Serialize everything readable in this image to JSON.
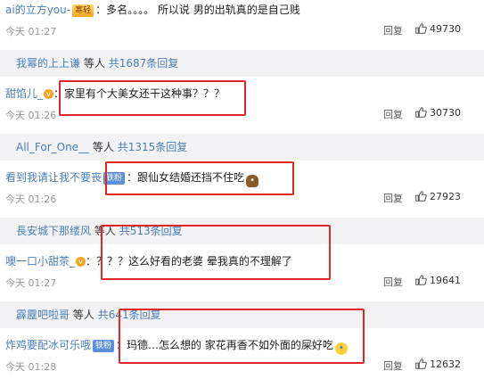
{
  "comments": [
    {
      "username": "ai的立方you-",
      "badge": "寒轻",
      "text": "多名。。。。 所以说 男的出轨真的是自己贱",
      "time": "今天 01:27",
      "reply": "回复",
      "likes": "49730"
    },
    {
      "username": "甜馅儿_",
      "badge": "",
      "text": "家里有个大美女还干这种事？？？",
      "time": "今天 01:26",
      "reply": "回复",
      "likes": "30730"
    },
    {
      "username": "看到我请让我不要丧",
      "badge": "铁粉",
      "text": "跟仙女结婚还挡不住吃",
      "emoji": "poop-icon",
      "time": "今天 01:26",
      "reply": "回复",
      "likes": "27923"
    },
    {
      "username": "噢一口小甜茶_",
      "badge": "",
      "text": "？？？这么好看的老婆 晕我真的不理解了",
      "time": "今天 01:27",
      "reply": "回复",
      "likes": "19641"
    },
    {
      "username": "炸鸡要配冰可乐哦",
      "badge": "铁粉",
      "text": "玛德…怎么想的 家花再香不如外面的屎好吃",
      "emoji": "crying-face-icon",
      "time": "今天 01:28",
      "reply": "回复",
      "likes": "12632"
    }
  ],
  "threads": [
    {
      "users": "我幂的上上谦",
      "etc": "等人",
      "count": "共1687条回复"
    },
    {
      "users": "All_For_One__",
      "etc": "等人",
      "count": "共1315条回复"
    },
    {
      "users": "長安城下那缕风",
      "etc": "等人",
      "count": "共513条回复"
    },
    {
      "users": "霹靂吧啦哥",
      "etc": "等人",
      "count": "共641条回复"
    }
  ],
  "colors": {
    "highlight": "#e02626",
    "link": "#4a7fb8",
    "thread_bg": "#f2f2f5"
  }
}
